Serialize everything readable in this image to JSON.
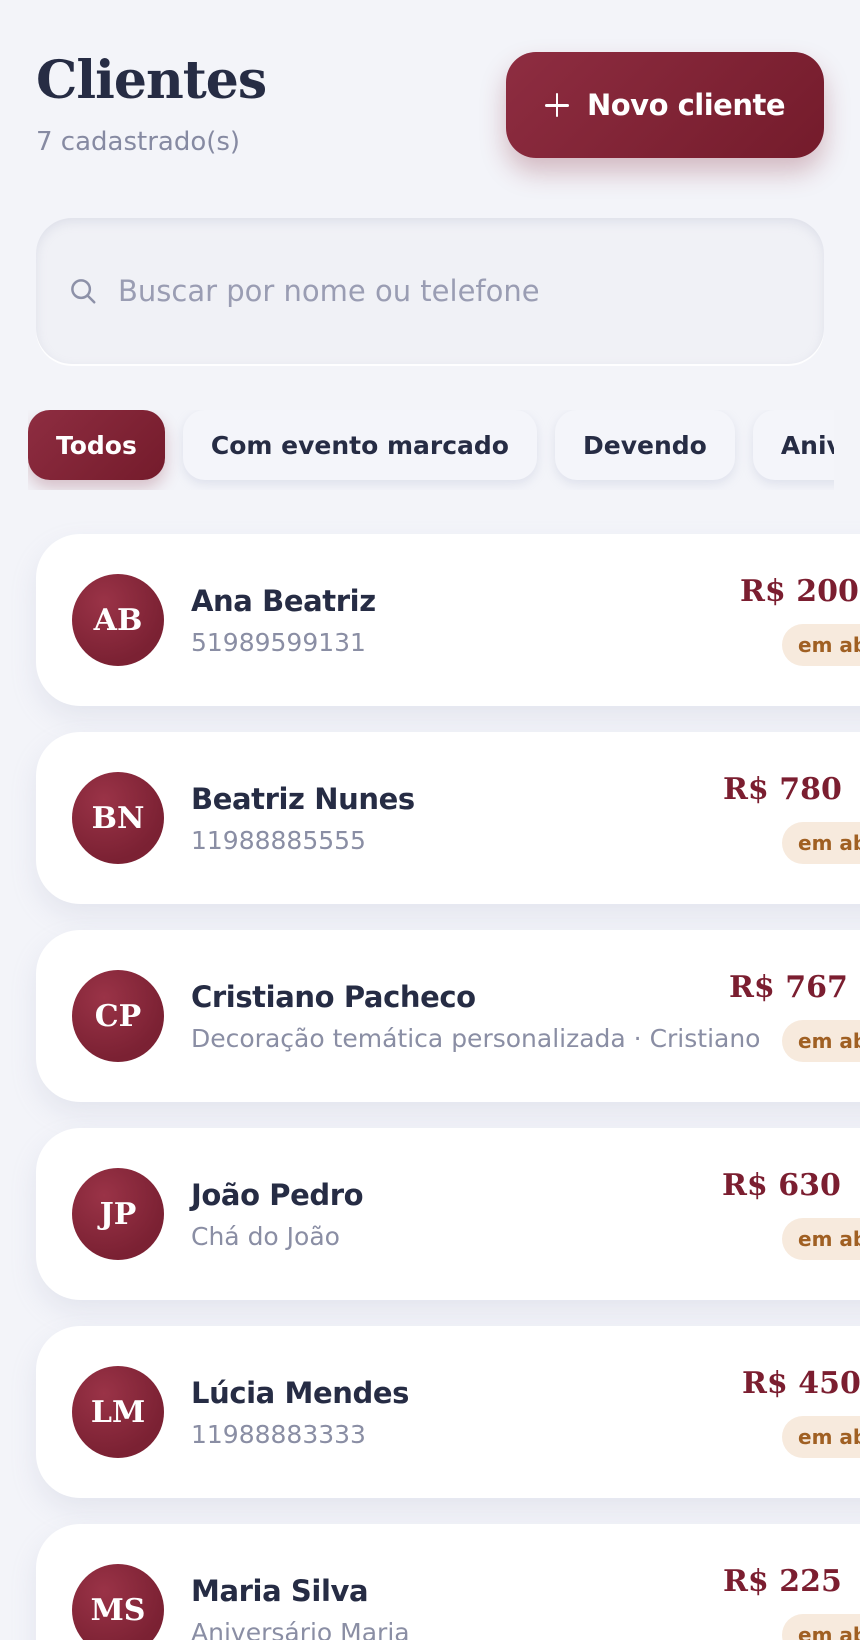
{
  "header": {
    "title": "Clientes",
    "subtitle": "7 cadastrado(s)",
    "new_button_label": "Novo cliente"
  },
  "search": {
    "placeholder": "Buscar por nome ou telefone",
    "value": ""
  },
  "filters": [
    {
      "label": "Todos",
      "active": true
    },
    {
      "label": "Com evento marcado",
      "active": false
    },
    {
      "label": "Devendo",
      "active": false
    },
    {
      "label": "Aniversariantes",
      "active": false
    }
  ],
  "clients": [
    {
      "initials": "AB",
      "name": "Ana Beatriz",
      "detail": "51989599131",
      "amount": "R$ 200",
      "status": "em aberto"
    },
    {
      "initials": "BN",
      "name": "Beatriz Nunes",
      "detail": "11988885555",
      "amount": "R$ 780",
      "status": "em aberto"
    },
    {
      "initials": "CP",
      "name": "Cristiano Pacheco",
      "detail": "Decoração temática personalizada · Cristiano",
      "amount": "R$ 767",
      "status": "em aberto"
    },
    {
      "initials": "JP",
      "name": "João Pedro",
      "detail": "Chá do João",
      "amount": "R$ 630",
      "status": "em aberto"
    },
    {
      "initials": "LM",
      "name": "Lúcia Mendes",
      "detail": "11988883333",
      "amount": "R$ 450",
      "status": "em aberto"
    },
    {
      "initials": "MS",
      "name": "Maria Silva",
      "detail": "Aniversário Maria",
      "amount": "R$ 225",
      "status": "em aberto"
    }
  ],
  "icons": {
    "add": "plus-icon",
    "search": "search-icon"
  },
  "colors": {
    "brand": "#7b1e30",
    "background": "#f3f4f9",
    "status_bg": "#f7eadd",
    "status_text": "#a06023"
  }
}
